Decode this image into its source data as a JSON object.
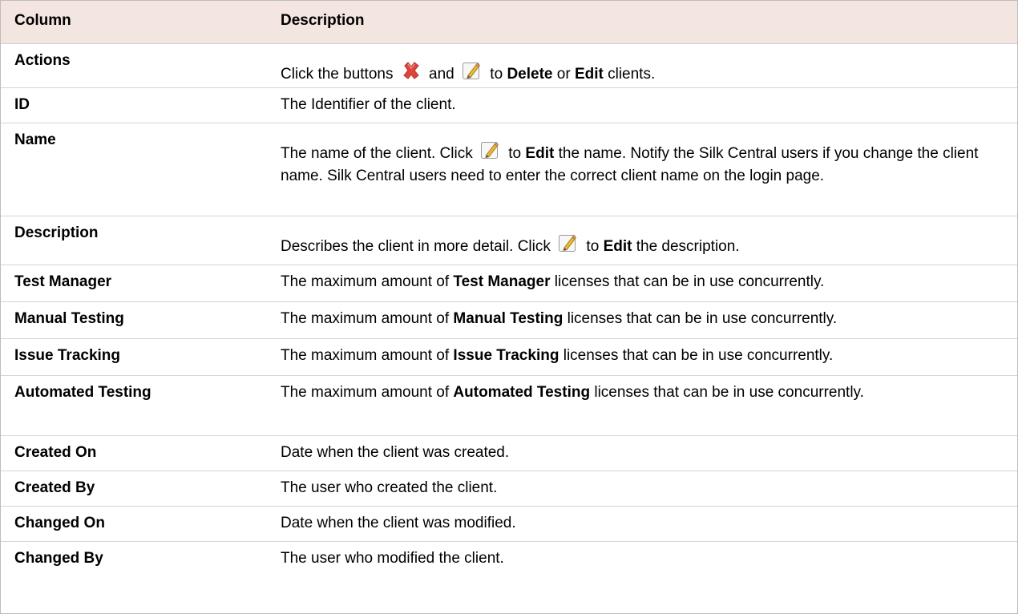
{
  "header": {
    "col1": "Column",
    "col2": "Description"
  },
  "icons": {
    "delete": "delete-x-icon",
    "edit": "edit-pencil-icon",
    "delete_color": "#e0453c",
    "edit_color": "#e8b93a"
  },
  "rows": {
    "actions": {
      "label": "Actions",
      "t1": "Click the buttons",
      "t2": "and",
      "t3": "to",
      "b1": "Delete",
      "t4": "or",
      "b2": "Edit",
      "t5": "clients."
    },
    "id": {
      "label": "ID",
      "text": "The Identifier of the client."
    },
    "name": {
      "label": "Name",
      "t1": "The name of the client. Click",
      "t2": "to",
      "b1": "Edit",
      "t3": "the name. Notify the Silk Central users if you change the client name. Silk Central users need to enter the correct client name on the login page."
    },
    "description": {
      "label": "Description",
      "t1": "Describes the client in more detail. Click",
      "t2": "to",
      "b1": "Edit",
      "t3": "the description."
    },
    "test_manager": {
      "label": "Test Manager",
      "t1": "The maximum amount of",
      "b1": "Test Manager",
      "t2": "licenses that can be in use concurrently."
    },
    "manual_testing": {
      "label": "Manual Testing",
      "t1": "The maximum amount of",
      "b1": "Manual Testing",
      "t2": "licenses that can be in use concurrently."
    },
    "issue_tracking": {
      "label": "Issue Tracking",
      "t1": "The maximum amount of",
      "b1": "Issue Tracking",
      "t2": "licenses that can be in use concurrently."
    },
    "automated_testing": {
      "label": "Automated Testing",
      "t1": "The maximum amount of",
      "b1": "Automated Testing",
      "t2": "licenses that can be in use concurrently."
    },
    "created_on": {
      "label": "Created On",
      "text": "Date when the client was created."
    },
    "created_by": {
      "label": "Created By",
      "text": "The user who created the client."
    },
    "changed_on": {
      "label": "Changed On",
      "text": "Date when the client was modified."
    },
    "changed_by": {
      "label": "Changed By",
      "text": "The user who modified the client."
    }
  }
}
